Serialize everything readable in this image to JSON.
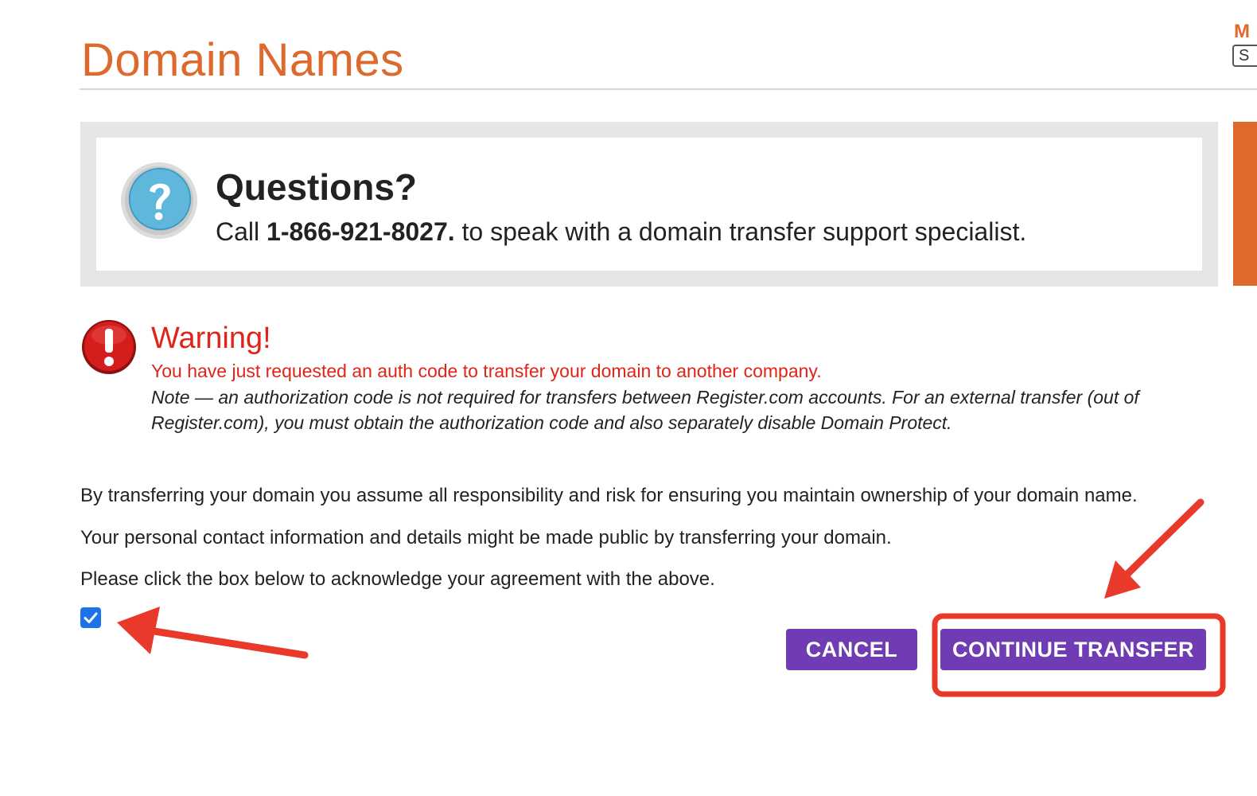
{
  "header": {
    "title": "Domain Names",
    "corner_letter": "M",
    "corner_box_text": "S"
  },
  "questions": {
    "icon": "question-icon",
    "title": "Questions?",
    "call_prefix": "Call ",
    "phone": "1-866-921-8027.",
    "call_suffix": " to speak with a domain transfer support specialist."
  },
  "warning": {
    "icon": "exclamation-icon",
    "title": "Warning!",
    "message": "You have just requested an auth code to transfer your domain to another company.",
    "note": "Note — an authorization code is not required for transfers between Register.com accounts. For an external transfer (out of Register.com), you must obtain the authorization code and also separately disable Domain Protect."
  },
  "terms": {
    "line1": "By transferring your domain you assume all responsibility and risk for ensuring you maintain ownership of your domain name.",
    "line2": "Your personal contact information and details might be made public by transferring your domain.",
    "line3": "Please click the box below to acknowledge your agreement with the above."
  },
  "agreement_checkbox": {
    "checked": true
  },
  "actions": {
    "cancel_label": "CANCEL",
    "continue_label": "CONTINUE TRANSFER"
  },
  "colors": {
    "brand_orange": "#dd6a2c",
    "button_purple": "#6f3cb4",
    "warning_red": "#e02418",
    "checkbox_blue": "#1a73e8",
    "annotation_red": "#e8392a"
  }
}
